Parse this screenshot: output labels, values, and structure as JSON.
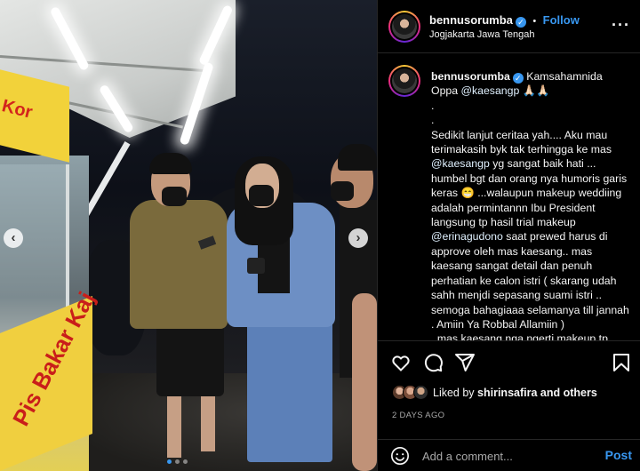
{
  "post": {
    "author": "bennusorumba",
    "follow_label": "Follow",
    "separator": "•",
    "location": "Jogjakarta Jawa Tengah",
    "more_label": "···"
  },
  "photo": {
    "sign_text": "Kor",
    "cart_text": "Pis Bakar Kaj",
    "prev_arrow": "‹",
    "next_arrow": "›",
    "slide_count": 3,
    "active_slide": 0
  },
  "caption": {
    "author": "bennusorumba",
    "line_1_rest": " Kamsahamnida",
    "line_2_prefix": "Oppa ",
    "mention_1": "@kaesangp",
    "line_2_suffix": " 🙏🏻🙏🏻",
    "dot_1": ".",
    "dot_2": ".",
    "para_1": "Sedikit lanjut ceritaa yah.... Aku mau terimakasih byk tak terhingga ke mas",
    "mention_2": "@kaesangp",
    "para_2": " yg sangat baik hati ... humbel bgt dan orang nya humoris garis keras 😁 ...walaupun makeup weddiing adalah permintannn Ibu President langsung tp hasil trial makeup ",
    "mention_3": "@erinagudono",
    "para_3": " saat prewed harus di approve oleh mas kaesang.. mas kaesang sangat detail dan penuh perhatian ke calon istri ( skarang udah sahh menjdi sepasang suami istri .. semoga bahagiaaa selamanya till jannah . Amiin Ya Robbal Allamiin )",
    "para_4": "..mas kaesang nga ngerti makeup tp"
  },
  "actions": {
    "like_icon": "heart-icon",
    "comment_icon": "comment-icon",
    "share_icon": "share-icon",
    "save_icon": "bookmark-icon"
  },
  "likes": {
    "prefix": "Liked by ",
    "user": "shirinsafira",
    "suffix": " and others"
  },
  "timestamp": "2 DAYS AGO",
  "comment": {
    "emoji_icon": "smiley-icon",
    "placeholder": "Add a comment...",
    "post_label": "Post"
  },
  "colors": {
    "accent": "#3897f0",
    "background": "#000000",
    "text": "#f5f5f5",
    "muted": "#a8a8a8"
  }
}
